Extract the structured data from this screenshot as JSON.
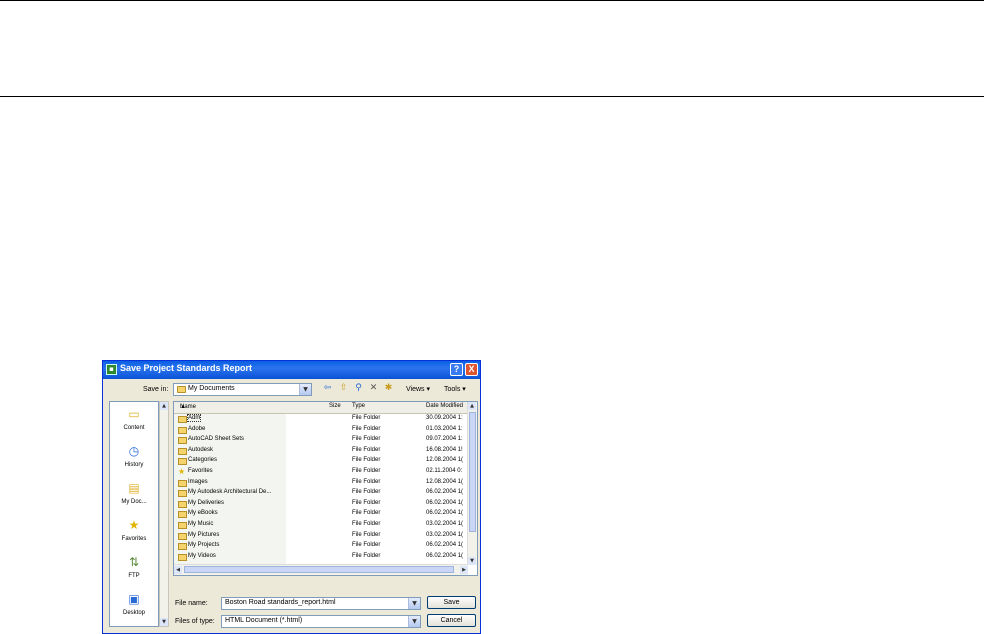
{
  "dialog": {
    "title": "Save Project Standards Report",
    "help_button": "?",
    "close_button": "X"
  },
  "toolbar": {
    "save_in_label": "Save in:",
    "save_in_value": "My Documents",
    "views_label": "Views",
    "tools_label": "Tools"
  },
  "places": [
    {
      "label": "Content",
      "icon": "folder-icon"
    },
    {
      "label": "History",
      "icon": "history-icon"
    },
    {
      "label": "My Doc...",
      "icon": "my-documents-icon"
    },
    {
      "label": "Favorites",
      "icon": "favorites-star-icon"
    },
    {
      "label": "FTP",
      "icon": "ftp-icon"
    },
    {
      "label": "Desktop",
      "icon": "desktop-icon"
    }
  ],
  "columns": {
    "name": "Name",
    "size": "Size",
    "type": "Type",
    "date": "Date Modified"
  },
  "files": [
    {
      "name": "Adm",
      "type": "File Folder",
      "date": "30.09.2004 1:"
    },
    {
      "name": "Adobe",
      "type": "File Folder",
      "date": "01.03.2004 1:"
    },
    {
      "name": "AutoCAD Sheet Sets",
      "type": "File Folder",
      "date": "09.07.2004 1:"
    },
    {
      "name": "Autodesk",
      "type": "File Folder",
      "date": "16.08.2004 1!"
    },
    {
      "name": "Categories",
      "type": "File Folder",
      "date": "12.08.2004 1("
    },
    {
      "name": "Favorites",
      "type": "File Folder",
      "date": "02.11.2004 0:"
    },
    {
      "name": "Images",
      "type": "File Folder",
      "date": "12.08.2004 1("
    },
    {
      "name": "My Autodesk Architectural De...",
      "type": "File Folder",
      "date": "06.02.2004 1("
    },
    {
      "name": "My Deliveries",
      "type": "File Folder",
      "date": "06.02.2004 1("
    },
    {
      "name": "My eBooks",
      "type": "File Folder",
      "date": "06.02.2004 1("
    },
    {
      "name": "My Music",
      "type": "File Folder",
      "date": "03.02.2004 1("
    },
    {
      "name": "My Pictures",
      "type": "File Folder",
      "date": "03.02.2004 1("
    },
    {
      "name": "My Projects",
      "type": "File Folder",
      "date": "06.02.2004 1("
    },
    {
      "name": "My Videos",
      "type": "File Folder",
      "date": "06.02.2004 1("
    }
  ],
  "file_name": {
    "label": "File name:",
    "value": "Boston Road standards_report.html"
  },
  "file_type": {
    "label": "Files of type:",
    "value": "HTML Document (*.html)"
  },
  "buttons": {
    "save": "Save",
    "cancel": "Cancel"
  }
}
